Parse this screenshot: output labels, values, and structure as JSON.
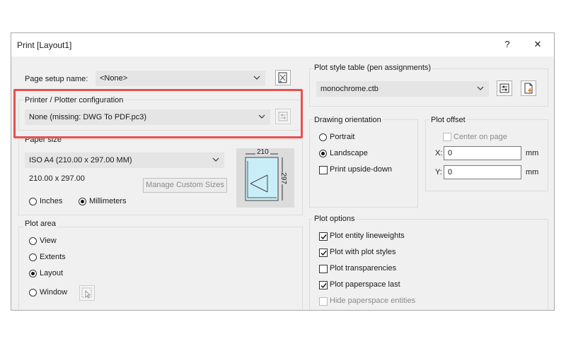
{
  "window": {
    "title": "Print [Layout1]",
    "help_label": "?",
    "close_label": "✕"
  },
  "page_setup": {
    "label": "Page setup name:",
    "value": "<None>"
  },
  "printer": {
    "group_label": "Printer / Plotter configuration",
    "value": "None  (missing: DWG To PDF.pc3)"
  },
  "paper": {
    "group_label": "Paper size",
    "value": "ISO A4 (210.00 x 297.00 MM)",
    "dimensions": "210.00 x 297.00",
    "manage_button": "Manage Custom Sizes",
    "units": [
      {
        "label": "Inches",
        "selected": false
      },
      {
        "label": "Millimeters",
        "selected": true
      }
    ],
    "preview_width": "210",
    "preview_height": "297"
  },
  "plot_area": {
    "group_label": "Plot area",
    "options": [
      {
        "label": "View",
        "selected": false
      },
      {
        "label": "Extents",
        "selected": false
      },
      {
        "label": "Layout",
        "selected": true
      },
      {
        "label": "Window",
        "selected": false
      }
    ]
  },
  "plot_style": {
    "group_label": "Plot style table (pen assignments)",
    "value": "monochrome.ctb"
  },
  "orientation": {
    "group_label": "Drawing orientation",
    "portrait": "Portrait",
    "landscape": "Landscape",
    "selected": "Landscape",
    "upside_down": "Print upside-down",
    "upside_down_checked": false
  },
  "plot_offset": {
    "group_label": "Plot offset",
    "center_label": "Center on page",
    "x_label": "X:",
    "x_value": "0",
    "x_unit": "mm",
    "y_label": "Y:",
    "y_value": "0",
    "y_unit": "mm"
  },
  "plot_options": {
    "group_label": "Plot options",
    "items": [
      {
        "label": "Plot entity lineweights",
        "checked": true,
        "enabled": true
      },
      {
        "label": "Plot with plot styles",
        "checked": true,
        "enabled": true
      },
      {
        "label": "Plot transparencies",
        "checked": false,
        "enabled": true
      },
      {
        "label": "Plot paperspace last",
        "checked": true,
        "enabled": true
      },
      {
        "label": "Hide paperspace entities",
        "checked": false,
        "enabled": false
      }
    ]
  },
  "colors": {
    "highlight": "#e8504f",
    "combo_bg": "#e5e5e5",
    "dialog_bg": "#f0f0f0"
  }
}
